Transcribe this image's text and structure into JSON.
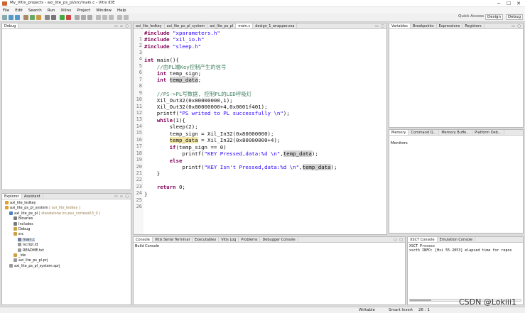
{
  "window": {
    "title": "My_Vitis_projects - axi_lite_ps_pl/src/main.c - Vitis IDE",
    "controls": [
      "─",
      "☐",
      "✕"
    ]
  },
  "menu": [
    "File",
    "Edit",
    "Search",
    "Run",
    "Xilinx",
    "Project",
    "Window",
    "Help"
  ],
  "toolbar": {
    "quick_access": "Quick Access",
    "perspectives": [
      "Design",
      "Debug"
    ]
  },
  "debug_view": {
    "tab": "Debug"
  },
  "explorer": {
    "tabs": [
      "Explorer",
      "Assistant"
    ],
    "tree": [
      {
        "label": "axi_lite_ledkey",
        "dim": "",
        "indent": 0
      },
      {
        "label": "axi_lite_ps_pl_system",
        "dim": "[ axi_lite_ledkey ]",
        "indent": 0
      },
      {
        "label": "axi_lite_ps_pl",
        "dim": "[ standalone on psu_cortexa53_0 ]",
        "indent": 1
      },
      {
        "label": "Binaries",
        "dim": "",
        "indent": 2
      },
      {
        "label": "Includes",
        "dim": "",
        "indent": 2
      },
      {
        "label": "Debug",
        "dim": "",
        "indent": 2
      },
      {
        "label": "src",
        "dim": "",
        "indent": 2
      },
      {
        "label": "main.c",
        "dim": "",
        "indent": 3
      },
      {
        "label": "lscript.ld",
        "dim": "",
        "indent": 3
      },
      {
        "label": "README.txt",
        "dim": "",
        "indent": 3
      },
      {
        "label": "_ide",
        "dim": "",
        "indent": 2
      },
      {
        "label": "axi_lite_ps_pl.prj",
        "dim": "",
        "indent": 2
      },
      {
        "label": "axi_lite_ps_pl_system.sprj",
        "dim": "",
        "indent": 1
      }
    ]
  },
  "editor": {
    "tabs": [
      "axi_lite_ledkey",
      "axi_lite_ps_pl_system",
      "axi_lite_ps_pl",
      "main.c",
      "design_1_wrapper.xsa"
    ],
    "active_tab": 3,
    "lines": [
      "#include \"xparameters.h\"",
      "#include \"xil_io.h\"",
      "#include \"sleep.h\"",
      "",
      "int main(){",
      "    //由PL端Key控制产生的信号",
      "    int temp_sign;",
      "    int temp_data;",
      "",
      "    //PS->PL写数据, 控制PL的LED呼吸灯",
      "    Xil_Out32(0x80000000,1);",
      "    Xil_Out32(0x80000000+4,0x0001f401);",
      "    printf(\"PS writed to PL successfully \\n\");",
      "    while(1){",
      "        sleep(2);",
      "        temp_sign = Xil_In32(0x80000000);",
      "        temp_data = Xil_In32(0x80000000+4);",
      "        if(temp_sign == 0)",
      "            printf(\"KEY Pressed,data:%d \\n\",temp_data);",
      "        else",
      "            printf(\"KEY Isn't Pressed,data:%d \\n\",temp_data);",
      "    }",
      "",
      "    return 0;",
      "}",
      ""
    ]
  },
  "variables": {
    "tabs": [
      "Variables",
      "Breakpoints",
      "Expressions",
      "Registers"
    ]
  },
  "memory": {
    "tabs": [
      "Memory",
      "Command Q...",
      "Memory Buffe...",
      "Platform Deb..."
    ],
    "monitors_label": "Monitors"
  },
  "console": {
    "tabs": [
      "Console",
      "Vitis Serial Terminal",
      "Executables",
      "Vitis Log",
      "Problems",
      "Debugger Console"
    ],
    "title": "Build Console"
  },
  "xsct": {
    "tabs": [
      "XSCT Console",
      "Emulation Console"
    ],
    "lines": [
      "XSCT Process",
      "xsct% INFO: [Hsi 55-2053] elapsed time for repos"
    ]
  },
  "status": {
    "mode": "Writable",
    "insert": "Smart Insert",
    "position": "26 : 1"
  },
  "watermark": "CSDN @Lokiii1",
  "colors": {
    "keyword": "#7f0055",
    "string": "#2a00ff",
    "comment": "#3f7f5f",
    "highlight": "#d4d4d4"
  }
}
